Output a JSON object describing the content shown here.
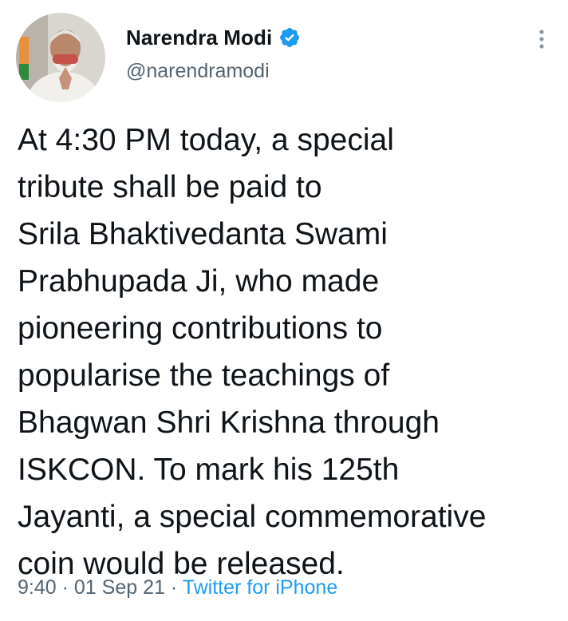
{
  "author": {
    "display_name": "Narendra Modi",
    "handle": "@narendramodi",
    "verified": true
  },
  "tweet": {
    "text": "At 4:30 PM today, a special\ntribute shall be paid to\nSrila Bhaktivedanta Swami\nPrabhupada Ji, who made\npioneering contributions to\npopularise the teachings of\nBhagwan Shri Krishna through\nISKCON. To mark his 125th\nJayanti, a special commemorative\ncoin would be released."
  },
  "meta": {
    "time": "9:40",
    "separator": "·",
    "date": "01 Sep 21",
    "source": "Twitter for iPhone"
  },
  "icons": {
    "verified": "verified-badge-icon",
    "more": "more-vertical-icon"
  },
  "colors": {
    "accent": "#1d9bf0",
    "text_primary": "#0f1419",
    "text_secondary": "#536471"
  }
}
